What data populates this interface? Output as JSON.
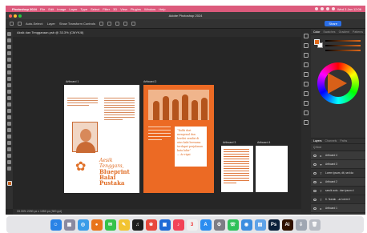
{
  "menubar": {
    "app_name": "Photoshop 2024",
    "items": [
      "File",
      "Edit",
      "Image",
      "Layer",
      "Type",
      "Select",
      "Filter",
      "3D",
      "View",
      "Plugins",
      "Window",
      "Help"
    ],
    "clock": "Wed 3 Jan 12:06",
    "colors": {
      "bar": "#dc5a7c"
    }
  },
  "window": {
    "title": "Adobe Photoshop 2024",
    "document_tab": "Aksik dan Tenggaraan.psb @ 33.3% (CMYK/8)",
    "options": {
      "auto_select": "Auto-Select:",
      "layer": "Layer",
      "show_transform": "Show Transform Controls",
      "share_label": "Share"
    },
    "status": "33.33%    2250 px x 1350 px (300 ppi)"
  },
  "artboards": [
    {
      "label": "Artboard 1",
      "title_line1": "Aesik",
      "title_line2": "Tenggara,",
      "title_line3": "Blueprint",
      "title_line4": "Balai Pustaka"
    },
    {
      "label": "Artboard 2",
      "quote": "“Kalik dari mengenal dan berdiri sendiri di atas kaki bersama terdapat perjalanan kata lahir”",
      "quote_credit": "— Ar rigai"
    },
    {
      "label": "Artboard 3"
    },
    {
      "label": "Artboard 4"
    }
  ],
  "panels": {
    "color_tabs": [
      "Color",
      "Swatches",
      "Gradient",
      "Patterns"
    ],
    "layers_tabs": [
      "Layers",
      "Channels",
      "Paths"
    ],
    "layer_kind_filter": "Q Kind",
    "layers": [
      {
        "name": "Artboard 4",
        "kind": "group"
      },
      {
        "name": "Artboard 3",
        "kind": "group"
      },
      {
        "name": "Lorem ipsum, dit, sed da",
        "kind": "text"
      },
      {
        "name": "Artboard 2",
        "kind": "group"
      },
      {
        "name": "sarsik auto...dan ipsum d",
        "kind": "text"
      },
      {
        "name": "K. Nanak ...ar lorem ll",
        "kind": "text"
      },
      {
        "name": "Artboard 1",
        "kind": "group"
      }
    ],
    "accent_color": "#e06a1c"
  },
  "dock": {
    "apps": [
      {
        "name": "finder",
        "color": "#2a83e6",
        "glyph": "☺"
      },
      {
        "name": "launchpad",
        "color": "#8a8aa0",
        "glyph": "▦"
      },
      {
        "name": "safari",
        "color": "#3a9ce8",
        "glyph": "◎"
      },
      {
        "name": "firefox",
        "color": "#e8741a",
        "glyph": "●"
      },
      {
        "name": "messages",
        "color": "#35c24a",
        "glyph": "✉"
      },
      {
        "name": "notes",
        "color": "#f2c431",
        "glyph": "✎"
      },
      {
        "name": "spotify",
        "color": "#1d1d1d",
        "glyph": "♫"
      },
      {
        "name": "photos",
        "color": "#e8483c",
        "glyph": "❀"
      },
      {
        "name": "app-blue",
        "color": "#1e6ad6",
        "glyph": "▣"
      },
      {
        "name": "music",
        "color": "#f24458",
        "glyph": "♪"
      },
      {
        "name": "calendar",
        "color": "#f0f0f0",
        "glyph": "3"
      },
      {
        "name": "appstore",
        "color": "#2b8df0",
        "glyph": "A"
      },
      {
        "name": "settings",
        "color": "#7d7d85",
        "glyph": "⚙"
      },
      {
        "name": "whatsapp",
        "color": "#2fc15a",
        "glyph": "☏"
      },
      {
        "name": "chrome",
        "color": "#3c8ee0",
        "glyph": "◉"
      },
      {
        "name": "preview",
        "color": "#5fa3e8",
        "glyph": "▤"
      },
      {
        "name": "photoshop",
        "color": "#0a1f3a",
        "glyph": "Ps"
      },
      {
        "name": "illustrator",
        "color": "#2e1000",
        "glyph": "Ai"
      },
      {
        "name": "downloads",
        "color": "#9fa6b2",
        "glyph": "⇩"
      },
      {
        "name": "trash",
        "color": "#b8bcc4",
        "glyph": "🗑"
      }
    ]
  }
}
